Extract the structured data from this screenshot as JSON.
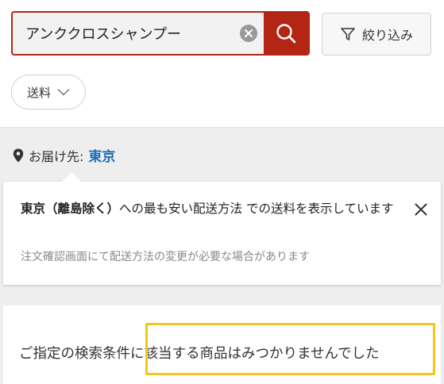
{
  "search": {
    "query": "アンククロスシャンプー",
    "clear_icon": "close-circle-icon",
    "search_icon": "magnifier-icon"
  },
  "filter": {
    "label": "絞り込み",
    "icon": "funnel-icon"
  },
  "shipping_chip": {
    "label": "送料",
    "icon": "chevron-down-icon"
  },
  "delivery": {
    "prefix": "お届け先:",
    "location": "東京",
    "icon": "location-pin-icon"
  },
  "notice": {
    "highlight": "東京（離島除く）",
    "text": "への最も安い配送方法 での送料を表示しています",
    "note": "注文確認画面にて配送方法の変更が必要な場合があります",
    "close_icon": "close-icon"
  },
  "results": {
    "message": "ご指定の検索条件に該当する商品はみつかりませんでした"
  },
  "colors": {
    "accent": "#b32614",
    "link": "#1f6fb5",
    "highlight_border": "#f5c518",
    "band": "#eeeeee"
  }
}
